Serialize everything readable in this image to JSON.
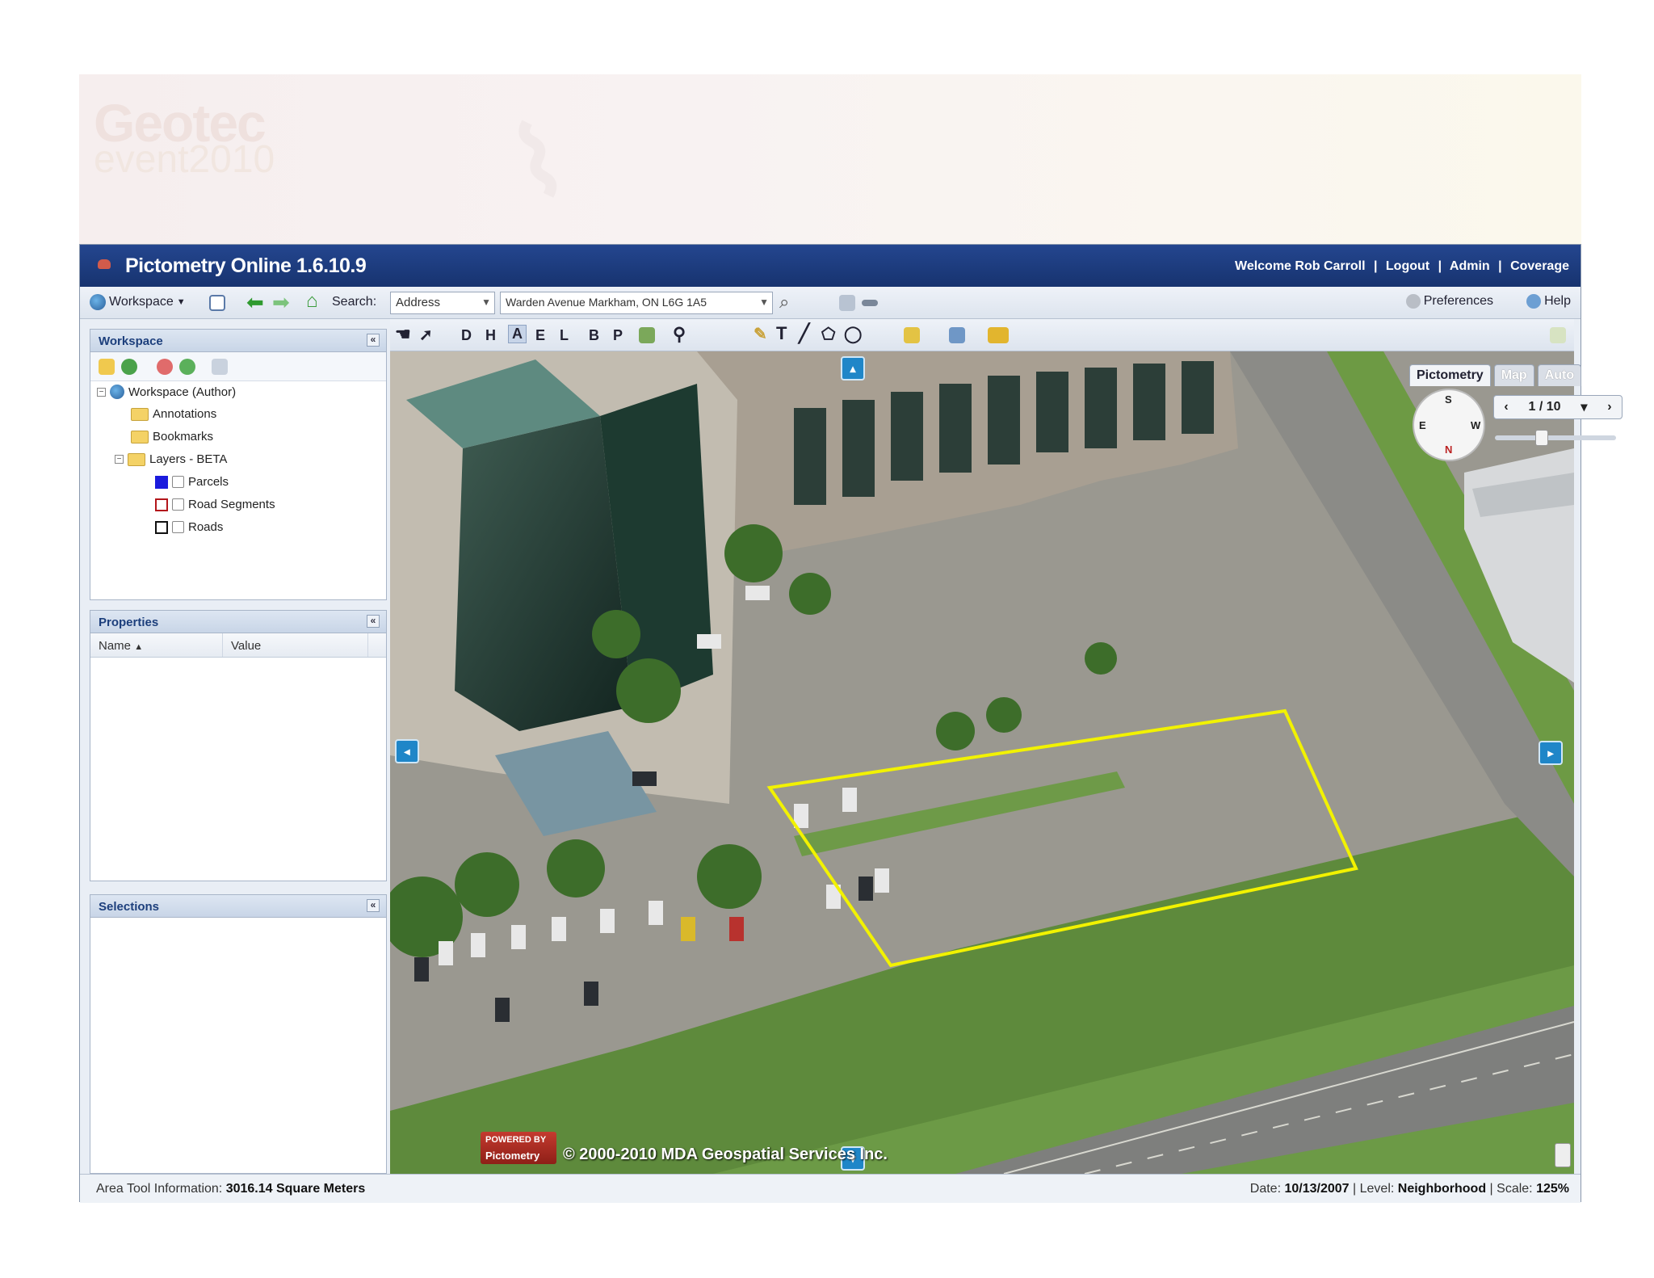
{
  "slide": {
    "logo_line1": "Geotec",
    "logo_line2": "event2010"
  },
  "titlebar": {
    "app_title": "Pictometry Online 1.6.10.9",
    "welcome": "Welcome Rob Carroll",
    "logout": "Logout",
    "admin": "Admin",
    "coverage": "Coverage",
    "separator": "|"
  },
  "toolbar": {
    "workspace_label": "Workspace",
    "search_label": "Search:",
    "search_type": "Address",
    "search_value": "Warden Avenue Markham, ON L6G 1A5",
    "preferences": "Preferences",
    "help": "Help"
  },
  "workspace_panel": {
    "title": "Workspace",
    "tree": {
      "root": "Workspace (Author)",
      "annotations": "Annotations",
      "bookmarks": "Bookmarks",
      "layers": "Layers - BETA",
      "parcels": "Parcels",
      "road_segments": "Road Segments",
      "roads": "Roads"
    },
    "layer_colors": {
      "parcels": "#1b1bdd",
      "road_segments": "#b3161b",
      "roads": "#111111"
    }
  },
  "properties_panel": {
    "title": "Properties",
    "col_name": "Name",
    "col_value": "Value"
  },
  "selections_panel": {
    "title": "Selections"
  },
  "map_toolbar": {
    "tools": [
      "D",
      "H",
      "A",
      "E",
      "L",
      "B",
      "P",
      "T"
    ]
  },
  "view_widget": {
    "tab_pictometry": "Pictometry",
    "tab_map": "Map",
    "tab_auto": "Auto",
    "image_index": "1 / 10",
    "compass_s": "S",
    "compass_e": "E",
    "compass_w": "W",
    "compass_n": "N"
  },
  "watermark": {
    "badge_top": "POWERED BY",
    "badge_name": "Pictometry",
    "copyright": "© 2000-2010 MDA Geospatial Services Inc."
  },
  "statusbar": {
    "area_label": "Area Tool Information:",
    "area_value": "3016.14 Square Meters",
    "date_label": "Date:",
    "date_value": "10/13/2007",
    "level_label": "Level:",
    "level_value": "Neighborhood",
    "scale_label": "Scale:",
    "scale_value": "125%"
  },
  "colors": {
    "title_bar": "#1b3a7c",
    "panel_header_text": "#1d3f7c",
    "measurement_polygon": "#f2f200",
    "nav_button": "#1f86c8"
  }
}
